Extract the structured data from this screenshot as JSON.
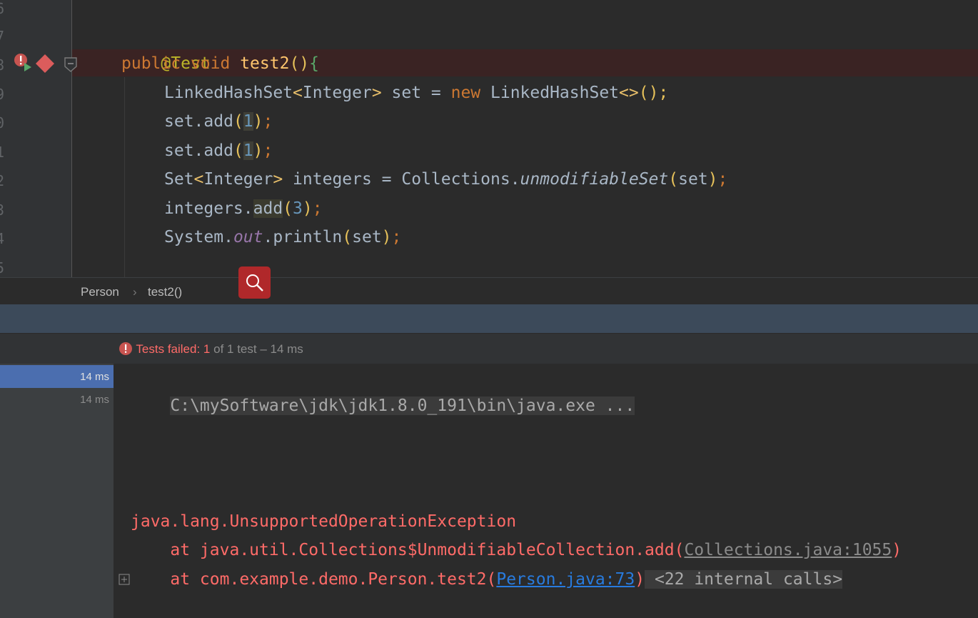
{
  "editor": {
    "line_numbers": [
      "6",
      "7",
      "8",
      "9",
      "0",
      "1",
      "2",
      "3",
      "4",
      "5"
    ],
    "annotation": "@Test",
    "method_sig": {
      "kw1": "public",
      "kw2": "void",
      "name": "test2",
      "parens": "()",
      "brace": "{"
    },
    "line_set_decl": {
      "type": "LinkedHashSet",
      "lt": "<",
      "gen": "Integer",
      "gt": ">",
      "var": " set = ",
      "kw": "new",
      "ctor": " LinkedHashSet",
      "diamond": "<>",
      "tail": "();"
    },
    "line_add1": {
      "pre": "set.add",
      "open": "(",
      "num": "1",
      "close": ")",
      "semi": ";"
    },
    "line_add2": {
      "pre": "set.add",
      "open": "(",
      "num": "1",
      "close": ")",
      "semi": ";"
    },
    "line_unmod": {
      "type": "Set",
      "lt": "<",
      "gen": "Integer",
      "gt": ">",
      "mid": " integers = Collections.",
      "call": "unmodifiableSet",
      "open": "(",
      "arg": "set",
      "close": ")",
      "semi": ";"
    },
    "line_integers_add": {
      "pre": "integers.",
      "call": "add",
      "open": "(",
      "num": "3",
      "close": ")",
      "semi": ";"
    },
    "line_println": {
      "pre": "System.",
      "field": "out",
      "mid": ".println",
      "open": "(",
      "arg": "set",
      "close": ")",
      "semi": ";"
    }
  },
  "breadcrumb": {
    "class": "Person",
    "sep": "›",
    "method": "test2()"
  },
  "run": {
    "status_label": "Tests failed: ",
    "failed_count": "1",
    "status_rest": " of 1 test – 14 ms",
    "tree_times": [
      "14 ms",
      "14 ms"
    ],
    "console": {
      "cmd": "C:\\mySoftware\\jdk\\jdk1.8.0_191\\bin\\java.exe ...",
      "exception": "java.lang.UnsupportedOperationException",
      "trace1_pre": "    at java.util.Collections$UnmodifiableCollection.add(",
      "trace1_link": "Collections.java:1055",
      "trace1_post": ")",
      "trace2_pre": "    at com.example.demo.Person.test2(",
      "trace2_link": "Person.java:73",
      "trace2_post": ")",
      "internal_calls": " <22 internal calls>"
    }
  },
  "colors": {
    "accent_selected": "#4b6eaf",
    "error": "#ff6b68",
    "link": "#287bde"
  }
}
